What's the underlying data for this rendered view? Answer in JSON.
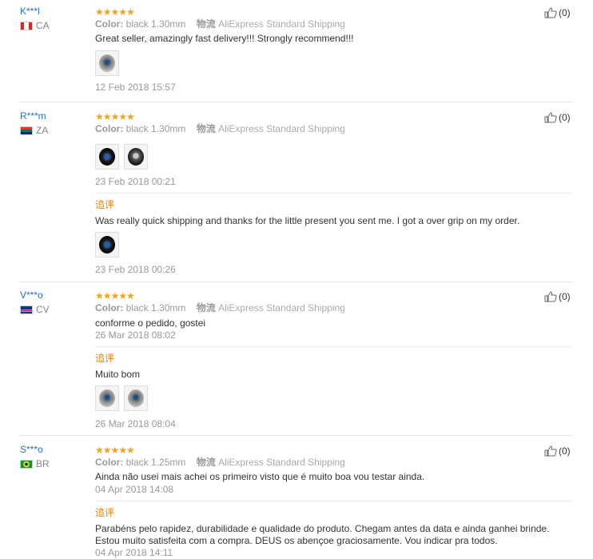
{
  "labels": {
    "color": "Color:",
    "logistics": "物流",
    "additional": "追评"
  },
  "reviews": [
    {
      "user": "K***l",
      "country": "CA",
      "stars": "★★★★★",
      "color_value": "black 1.30mm",
      "shipping": "AliExpress Standard Shipping",
      "text": "Great seller, amazingly fast delivery!!! Strongly recommend!!!",
      "date": "12 Feb 2018 15:57",
      "helpful": "(0)"
    },
    {
      "user": "R***m",
      "country": "ZA",
      "stars": "★★★★★",
      "color_value": "black 1.30mm",
      "shipping": "AliExpress Standard Shipping",
      "date": "23 Feb 2018 00:21",
      "followup_text": "Was really quick shipping and thanks for the little present you sent me. I got a over grip on my order.",
      "followup_date": "23 Feb 2018 00:26",
      "helpful": "(0)"
    },
    {
      "user": "V***o",
      "country": "CV",
      "stars": "★★★★★",
      "color_value": "black 1.30mm",
      "shipping": "AliExpress Standard Shipping",
      "text": "conforme o pedido, gostei",
      "date": "26 Mar 2018 08:02",
      "followup_text": "Muito bom",
      "followup_date": "26 Mar 2018 08:04",
      "helpful": "(0)"
    },
    {
      "user": "S***o",
      "country": "BR",
      "stars": "★★★★★",
      "color_value": "black 1.25mm",
      "shipping": "AliExpress Standard Shipping",
      "text": "Ainda não usei mais achei os primeiro visto que é muito boa vou testar ainda.",
      "date": "04 Apr 2018 14:08",
      "followup_text": "Parabéns pelo rapidez, durabilidade e qualidade do produto. Chegam antes da data e ainda ganhei brinde. Estou muito satisfeita com a compra. DEUS os abençoe graciosamente. Vou indicar pra todos.",
      "followup_date": "04 Apr 2018 14:11",
      "helpful": "(0)"
    }
  ]
}
